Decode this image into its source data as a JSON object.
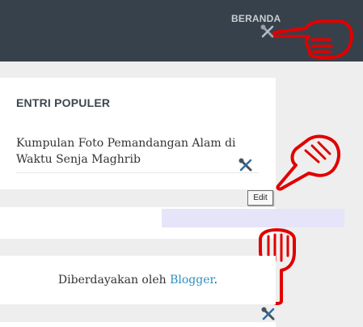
{
  "header": {
    "nav_link": "BERANDA"
  },
  "popular_widget": {
    "title": "ENTRI POPULER",
    "post_title": "Kumpulan Foto Pemandangan Alam di Waktu Senja Maghrib"
  },
  "tooltip": {
    "text": "Edit"
  },
  "footer": {
    "powered_prefix": "Diberdayakan oleh",
    "powered_link": "Blogger",
    "powered_suffix": "."
  },
  "icons": {
    "edit_icon": "wrench-screwdriver-icon",
    "pointer_annotation": "pointing-hand-icon"
  },
  "colors": {
    "header_bg": "#37414b",
    "page_bg": "#eeeeee",
    "link": "#2e8fc0",
    "annotation": "#e00000",
    "highlight": "#e5e4f8"
  }
}
